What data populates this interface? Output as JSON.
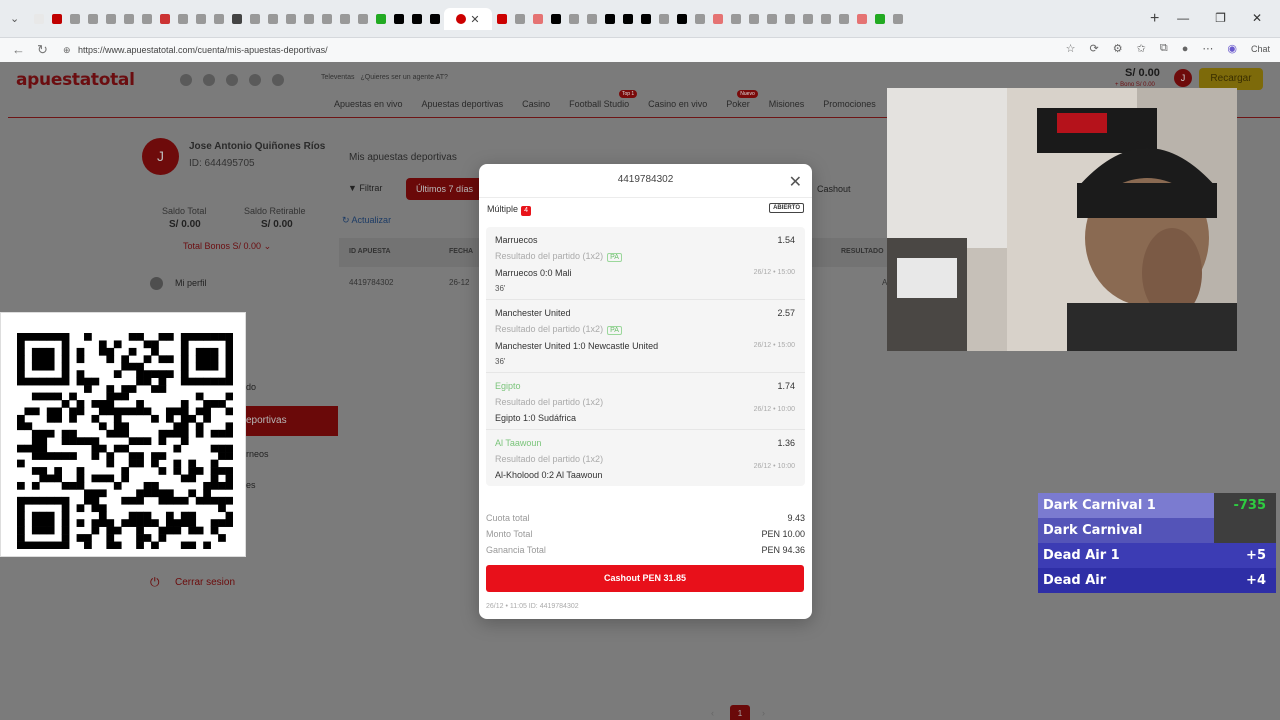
{
  "browser": {
    "tab_favicons": [
      "#e8e8e8",
      "#c00000",
      "#999999",
      "#999999",
      "#999999",
      "#999999",
      "#999999",
      "#cc3333",
      "#999999",
      "#999999",
      "#999999",
      "#444444",
      "#999999",
      "#999999",
      "#999999",
      "#999999",
      "#999999",
      "#999999",
      "#999999",
      "#22aa22",
      "#000000",
      "#000000",
      "#000000",
      "#cc0000",
      "#999999",
      "#e57373",
      "#000000",
      "#999999",
      "#999999",
      "#000000",
      "#000000",
      "#000000",
      "#999999",
      "#000000",
      "#999999",
      "#e57373",
      "#999999",
      "#999999",
      "#999999",
      "#999999",
      "#999999",
      "#999999",
      "#999999",
      "#e57373",
      "#22aa22",
      "#999999"
    ],
    "active_tab_icon": "opera-icon",
    "url": "https://www.apuestatotal.com/cuenta/mis-apuestas-deportivas/",
    "chat_label": "Chat"
  },
  "site": {
    "logo": "apuestatotal",
    "top_links": [
      "Televentas",
      "¿Quieres ser un agente AT?"
    ],
    "nav": [
      {
        "label": "Apuestas en vivo",
        "badge": ""
      },
      {
        "label": "Apuestas deportivas",
        "badge": ""
      },
      {
        "label": "Casino",
        "badge": ""
      },
      {
        "label": "Football Studio",
        "badge": "Top 1"
      },
      {
        "label": "Casino en vivo",
        "badge": ""
      },
      {
        "label": "Poker",
        "badge": "Nuevo"
      },
      {
        "label": "Misiones",
        "badge": ""
      },
      {
        "label": "Promociones",
        "badge": ""
      }
    ],
    "balance": "S/ 0.00",
    "bonus_mini": "+ Bono S/ 0.00",
    "avatar_letter": "J",
    "recharge_label": "Recargar"
  },
  "profile": {
    "avatar_letter": "J",
    "name": "Jose Antonio Quiñones Ríos",
    "id": "ID: 644495705",
    "saldo_total_label": "Saldo Total",
    "saldo_total": "S/ 0.00",
    "saldo_retirable_label": "Saldo Retirable",
    "saldo_retirable": "S/ 0.00",
    "bonos": "Total Bonos S/ 0.00",
    "menu_profile": "Mi perfil",
    "menu_partial_1": "do",
    "menu_active": "eportivas",
    "menu_partial_2": "rneos",
    "menu_partial_3": "es",
    "logout": "Cerrar sesion"
  },
  "bets": {
    "title": "Mis apuestas deportivas",
    "filter": "Filtrar",
    "period": "Últimos 7 días",
    "cashout_tab": "Cashout",
    "refresh": "Actualizar",
    "headers": [
      "ID APUESTA",
      "FECHA",
      "RESULTADO"
    ],
    "row": {
      "id": "4419784302",
      "date": "26-12",
      "result": "Abierto"
    },
    "page": "1"
  },
  "modal": {
    "title": "4419784302",
    "type": "Múltiple",
    "legs_count": "4",
    "status": "ABIERTO",
    "legs": [
      {
        "selection": "Marruecos",
        "odd": "1.54",
        "market": "Resultado del partido (1x2)",
        "pa": "PA",
        "match": "Marruecos 0:0 Mali",
        "minute": "36'",
        "time": "26/12 • 15:00",
        "won": false
      },
      {
        "selection": "Manchester United",
        "odd": "2.57",
        "market": "Resultado del partido (1x2)",
        "pa": "PA",
        "match": "Manchester United 1:0 Newcastle United",
        "minute": "36'",
        "time": "26/12 • 15:00",
        "won": false
      },
      {
        "selection": "Egipto",
        "odd": "1.74",
        "market": "Resultado del partido (1x2)",
        "pa": "",
        "match": "Egipto 1:0 Sudáfrica",
        "minute": "",
        "time": "26/12 • 10:00",
        "won": true
      },
      {
        "selection": "Al Taawoun",
        "odd": "1.36",
        "market": "Resultado del partido (1x2)",
        "pa": "",
        "match": "Al-Kholood 0:2 Al Taawoun",
        "minute": "",
        "time": "26/12 • 10:00",
        "won": true
      }
    ],
    "cuota_label": "Cuota total",
    "cuota": "9.43",
    "monto_label": "Monto Total",
    "monto": "PEN 10.00",
    "ganancia_label": "Ganancia Total",
    "ganancia": "PEN 94.36",
    "cashout_button": "Cashout PEN 31.85",
    "footer": "26/12 • 11:05   ID: 4419784302"
  },
  "scoreboard": [
    {
      "name": "Dark Carnival 1",
      "score": "-735",
      "name_bg": "#7b7bd0",
      "score_bg": "#3e3e3e",
      "score_color": "#2ecc40"
    },
    {
      "name": "Dark Carnival",
      "score": "",
      "name_bg": "#5454b8",
      "score_bg": "#3e3e3e",
      "score_color": "#ffffff"
    },
    {
      "name": "Dead Air 1",
      "score": "+5",
      "name_bg": "#3c3cb4",
      "score_bg": "#3c3cb4",
      "score_color": "#ffffff"
    },
    {
      "name": "Dead Air",
      "score": "+4",
      "name_bg": "#2e2ea6",
      "score_bg": "#2e2ea6",
      "score_color": "#ffffff"
    }
  ]
}
